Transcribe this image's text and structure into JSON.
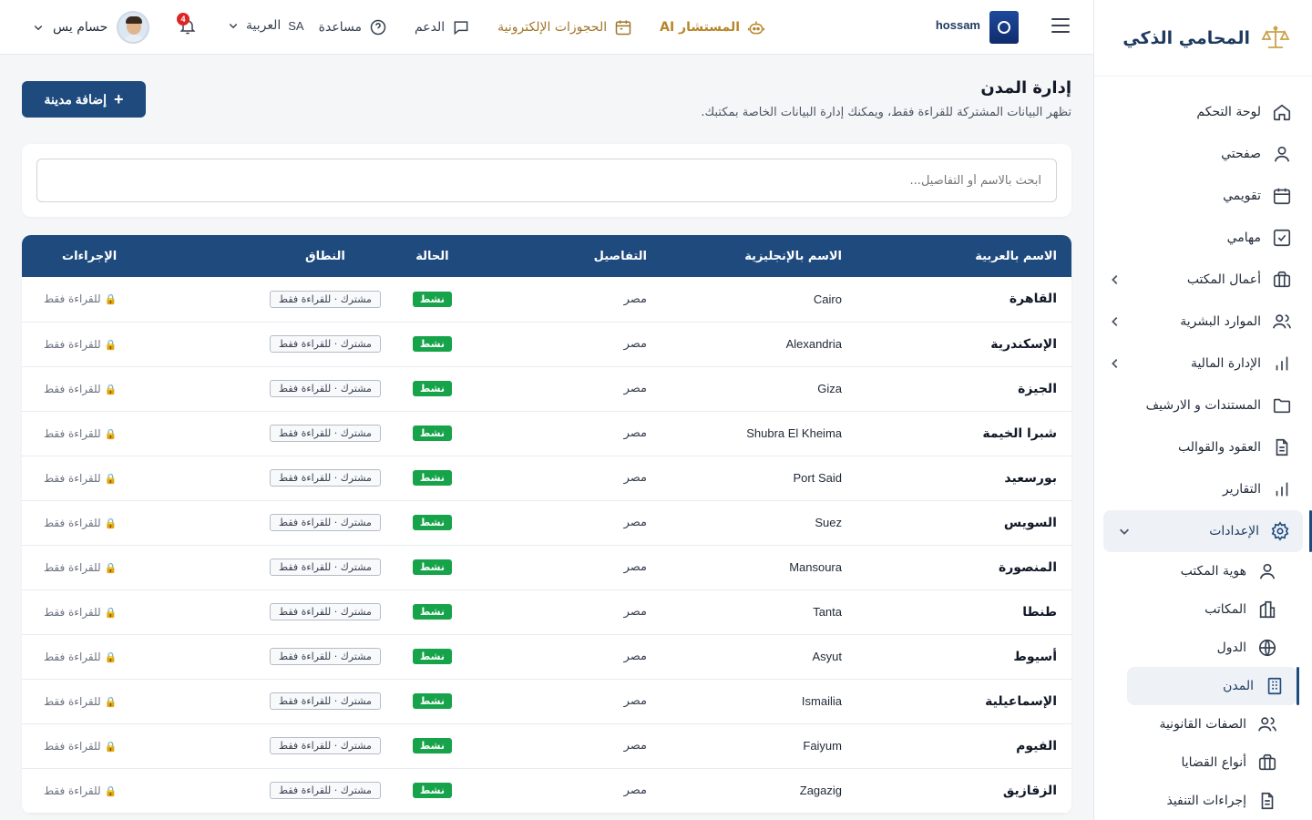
{
  "brand": {
    "title": "المحامي الذكي"
  },
  "sidebar": {
    "items": [
      {
        "label": "لوحة التحكم",
        "icon": "home-icon"
      },
      {
        "label": "صفحتي",
        "icon": "user-icon"
      },
      {
        "label": "تقويمي",
        "icon": "calendar-icon"
      },
      {
        "label": "مهامي",
        "icon": "checkbox-icon"
      },
      {
        "label": "أعمال المكتب",
        "icon": "briefcase-icon",
        "expandable": true
      },
      {
        "label": "الموارد البشرية",
        "icon": "users-icon",
        "expandable": true
      },
      {
        "label": "الإدارة المالية",
        "icon": "bar-chart-icon",
        "expandable": true
      },
      {
        "label": "المستندات و الارشيف",
        "icon": "folder-icon"
      },
      {
        "label": "العقود والقوالب",
        "icon": "file-text-icon"
      },
      {
        "label": "التقارير",
        "icon": "bar-chart-icon"
      },
      {
        "label": "الإعدادات",
        "icon": "gear-icon",
        "expanded": true,
        "active": true
      }
    ],
    "settings_sub": [
      {
        "label": "هوية المكتب",
        "icon": "user-icon"
      },
      {
        "label": "المكاتب",
        "icon": "building-icon"
      },
      {
        "label": "الدول",
        "icon": "globe-icon"
      },
      {
        "label": "المدن",
        "icon": "city-icon",
        "active": true
      },
      {
        "label": "الصفات القانونية",
        "icon": "users-icon"
      },
      {
        "label": "أنواع القضايا",
        "icon": "briefcase-icon"
      },
      {
        "label": "إجراءات التنفيذ",
        "icon": "file-text-icon"
      }
    ]
  },
  "header": {
    "org_name": "hossam",
    "links": {
      "ai": "المستشار AI",
      "bookings": "الحجوزات الإلكترونية",
      "support": "الدعم",
      "help": "مساعدة"
    },
    "language": "العربية",
    "language_code": "SA",
    "notifications_count": "4",
    "user_name": "حسام يس"
  },
  "page": {
    "title": "إدارة المدن",
    "subtitle": "تظهر البيانات المشتركة للقراءة فقط، ويمكنك إدارة البيانات الخاصة بمكتبك.",
    "add_button": "إضافة مدينة",
    "search_placeholder": "ابحث بالاسم أو التفاصيل..."
  },
  "table": {
    "headers": {
      "name_ar": "الاسم بالعربية",
      "name_en": "الاسم بالإنجليزية",
      "details": "التفاصيل",
      "status": "الحالة",
      "scope": "النطاق",
      "actions": "الإجراءات"
    },
    "rows": [
      {
        "name_ar": "القاهرة",
        "name_en": "Cairo",
        "details": "مصر",
        "status": "نشط",
        "scope": "مشترك · للقراءة فقط",
        "action": "للقراءة فقط"
      },
      {
        "name_ar": "الإسكندرية",
        "name_en": "Alexandria",
        "details": "مصر",
        "status": "نشط",
        "scope": "مشترك · للقراءة فقط",
        "action": "للقراءة فقط"
      },
      {
        "name_ar": "الجيزة",
        "name_en": "Giza",
        "details": "مصر",
        "status": "نشط",
        "scope": "مشترك · للقراءة فقط",
        "action": "للقراءة فقط"
      },
      {
        "name_ar": "شبرا الخيمة",
        "name_en": "Shubra El Kheima",
        "details": "مصر",
        "status": "نشط",
        "scope": "مشترك · للقراءة فقط",
        "action": "للقراءة فقط"
      },
      {
        "name_ar": "بورسعيد",
        "name_en": "Port Said",
        "details": "مصر",
        "status": "نشط",
        "scope": "مشترك · للقراءة فقط",
        "action": "للقراءة فقط"
      },
      {
        "name_ar": "السويس",
        "name_en": "Suez",
        "details": "مصر",
        "status": "نشط",
        "scope": "مشترك · للقراءة فقط",
        "action": "للقراءة فقط"
      },
      {
        "name_ar": "المنصورة",
        "name_en": "Mansoura",
        "details": "مصر",
        "status": "نشط",
        "scope": "مشترك · للقراءة فقط",
        "action": "للقراءة فقط"
      },
      {
        "name_ar": "طنطا",
        "name_en": "Tanta",
        "details": "مصر",
        "status": "نشط",
        "scope": "مشترك · للقراءة فقط",
        "action": "للقراءة فقط"
      },
      {
        "name_ar": "أسيوط",
        "name_en": "Asyut",
        "details": "مصر",
        "status": "نشط",
        "scope": "مشترك · للقراءة فقط",
        "action": "للقراءة فقط"
      },
      {
        "name_ar": "الإسماعيلية",
        "name_en": "Ismailia",
        "details": "مصر",
        "status": "نشط",
        "scope": "مشترك · للقراءة فقط",
        "action": "للقراءة فقط"
      },
      {
        "name_ar": "الفيوم",
        "name_en": "Faiyum",
        "details": "مصر",
        "status": "نشط",
        "scope": "مشترك · للقراءة فقط",
        "action": "للقراءة فقط"
      },
      {
        "name_ar": "الزقازيق",
        "name_en": "Zagazig",
        "details": "مصر",
        "status": "نشط",
        "scope": "مشترك · للقراءة فقط",
        "action": "للقراءة فقط"
      }
    ]
  },
  "colors": {
    "primary": "#1e4a7e",
    "gold": "#b8862a",
    "success": "#16a34a",
    "danger": "#dc2626"
  }
}
